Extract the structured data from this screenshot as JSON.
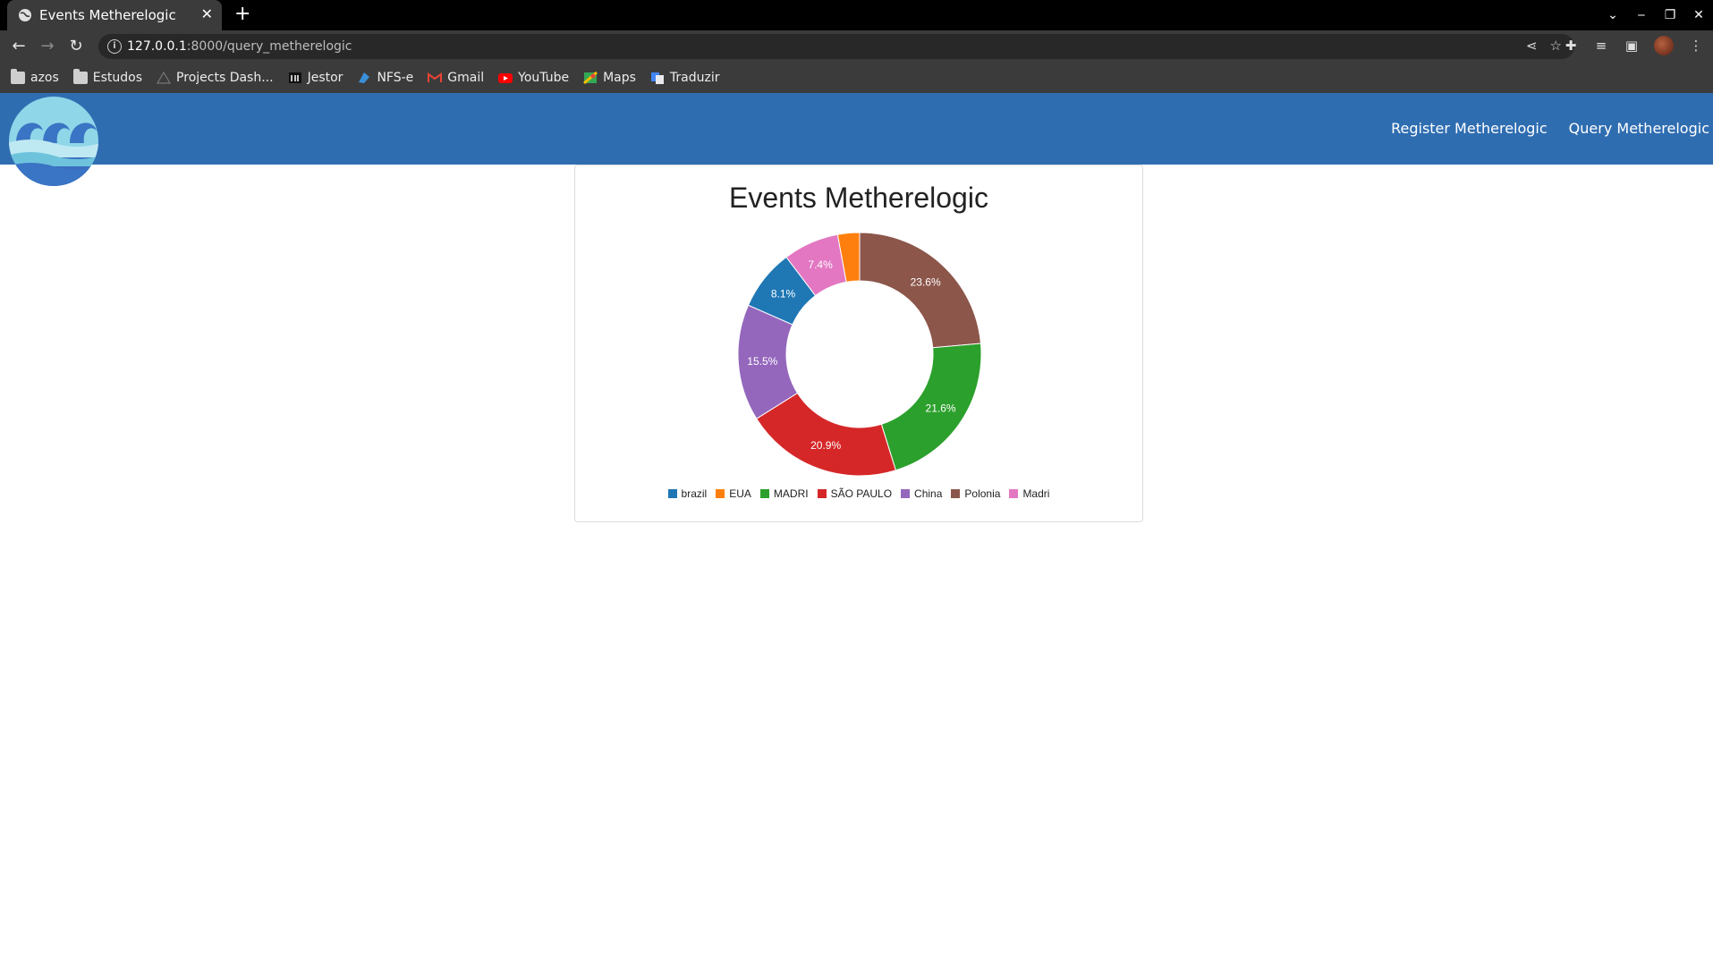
{
  "browser": {
    "tab_title": "Events Metherelogic",
    "tab_close": "✕",
    "new_tab": "+",
    "url_host": "127.0.0.1",
    "url_rest": ":8000/query_metherelogic",
    "bookmarks": [
      {
        "label": "azos",
        "icon": "folder-icon"
      },
      {
        "label": "Estudos",
        "icon": "folder-icon"
      },
      {
        "label": "Projects Dash...",
        "icon": "triangle-icon"
      },
      {
        "label": "Jestor",
        "icon": "jestor-icon"
      },
      {
        "label": "NFS-e",
        "icon": "nfse-icon"
      },
      {
        "label": "Gmail",
        "icon": "gmail-icon"
      },
      {
        "label": "YouTube",
        "icon": "youtube-icon"
      },
      {
        "label": "Maps",
        "icon": "maps-icon"
      },
      {
        "label": "Traduzir",
        "icon": "translate-icon"
      }
    ]
  },
  "navbar": {
    "register_label": "Register Metherelogic",
    "query_label": "Query Metherelogic",
    "brand_color": "#2f6db1"
  },
  "chart_data": {
    "type": "pie",
    "donut": true,
    "title": "Events Metherelogic",
    "categories": [
      "brazil",
      "EUA",
      "MADRI",
      "SÃO PAULO",
      "China",
      "Polonia",
      "Madri"
    ],
    "values": [
      8.1,
      2.9,
      21.6,
      20.9,
      15.5,
      23.6,
      7.4
    ],
    "data_labels": [
      "8.1%",
      "",
      "21.6%",
      "20.9%",
      "15.5%",
      "23.6%",
      "7.4%"
    ],
    "colors": [
      "#1f77b4",
      "#ff7f0e",
      "#2ca02c",
      "#d62728",
      "#9467bd",
      "#8c564b",
      "#e377c2"
    ],
    "legend_position": "bottom"
  }
}
